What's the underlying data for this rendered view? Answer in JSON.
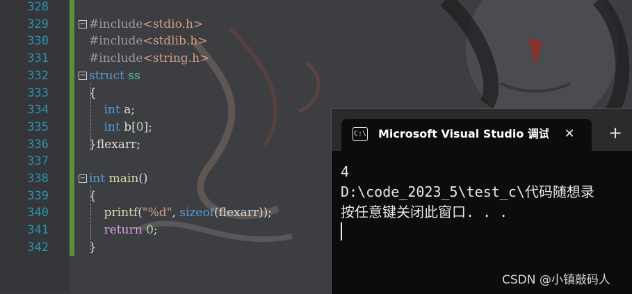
{
  "editor": {
    "lines": [
      {
        "num": "328"
      },
      {
        "num": "329",
        "tokens": [
          [
            "pre",
            "#include"
          ],
          [
            "str",
            "<stdio.h>"
          ]
        ]
      },
      {
        "num": "330",
        "tokens": [
          [
            "pre",
            "#include"
          ],
          [
            "str",
            "<stdlib.h>"
          ]
        ]
      },
      {
        "num": "331",
        "tokens": [
          [
            "pre",
            "#include"
          ],
          [
            "str",
            "<string.h>"
          ]
        ]
      },
      {
        "num": "332",
        "tokens": [
          [
            "kw",
            "struct"
          ],
          [
            "plain",
            " "
          ],
          [
            "type",
            "ss"
          ]
        ]
      },
      {
        "num": "333",
        "tokens": [
          [
            "plain",
            "{"
          ]
        ]
      },
      {
        "num": "334",
        "tokens": [
          [
            "plain",
            "    "
          ],
          [
            "kw",
            "int"
          ],
          [
            "plain",
            " a;"
          ]
        ]
      },
      {
        "num": "335",
        "tokens": [
          [
            "plain",
            "    "
          ],
          [
            "kw",
            "int"
          ],
          [
            "plain",
            " b["
          ],
          [
            "num",
            "0"
          ],
          [
            "plain",
            "];"
          ]
        ]
      },
      {
        "num": "336",
        "tokens": [
          [
            "plain",
            "}flexarr;"
          ]
        ]
      },
      {
        "num": "337"
      },
      {
        "num": "338",
        "tokens": [
          [
            "kw",
            "int"
          ],
          [
            "plain",
            " "
          ],
          [
            "fn",
            "main"
          ],
          [
            "plain",
            "()"
          ]
        ]
      },
      {
        "num": "339",
        "tokens": [
          [
            "plain",
            "{"
          ]
        ]
      },
      {
        "num": "340",
        "tokens": [
          [
            "plain",
            "    "
          ],
          [
            "fn",
            "printf"
          ],
          [
            "plain",
            "("
          ],
          [
            "str",
            "\"%d\""
          ],
          [
            "plain",
            ", "
          ],
          [
            "kw",
            "sizeof"
          ],
          [
            "plain",
            "(flexarr));"
          ]
        ]
      },
      {
        "num": "341",
        "tokens": [
          [
            "plain",
            "    "
          ],
          [
            "ctl",
            "return"
          ],
          [
            "plain",
            " "
          ],
          [
            "num",
            "0"
          ],
          [
            "plain",
            ";"
          ]
        ]
      },
      {
        "num": "342",
        "tokens": [
          [
            "plain",
            "}"
          ]
        ]
      }
    ]
  },
  "console": {
    "icon_text": "C:\\",
    "tab_title": "Microsoft Visual Studio 调试控制台",
    "close_glyph": "✕",
    "new_tab_glyph": "+",
    "output": "4\nD:\\code_2023_5\\test_c\\代码随想录\n按任意键关闭此窗口. . ."
  },
  "watermark": "CSDN @小镇敲码人",
  "colors": {
    "line_number": "#2b91af",
    "keyword": "#569cd6",
    "string": "#d69d85",
    "type": "#4ec9b0",
    "change_bar": "#5f8f3a",
    "console_bg": "#0c0c0c"
  }
}
